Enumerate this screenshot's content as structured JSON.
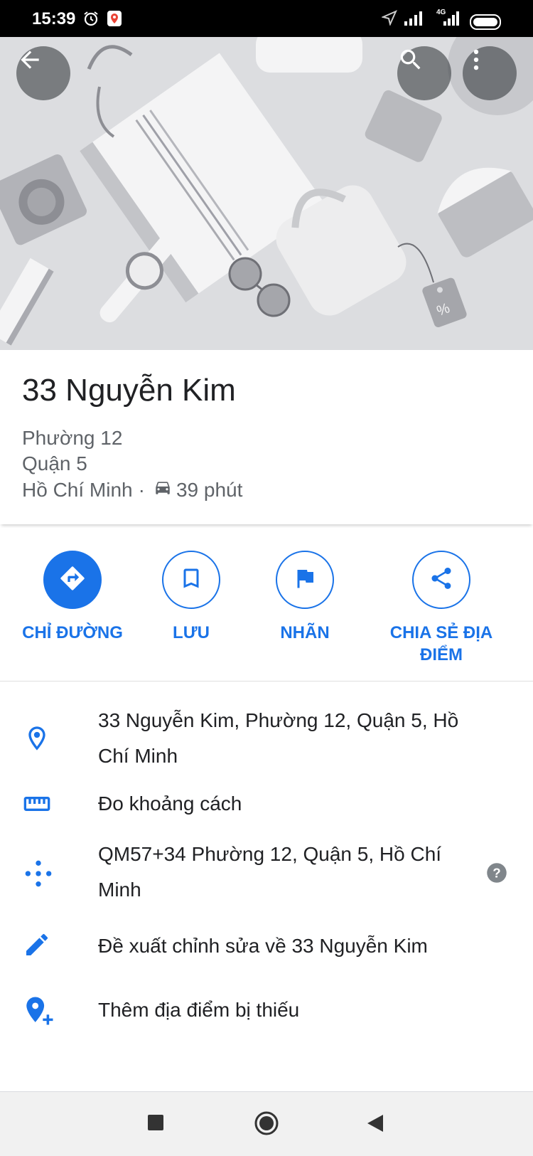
{
  "status_bar": {
    "time": "15:39",
    "icons": [
      "alarm-icon",
      "maps-notification-icon",
      "location-arrow-icon",
      "signal-icon",
      "4g-signal-icon",
      "battery-icon"
    ],
    "network_label": "4G"
  },
  "top_actions": {
    "back_icon": "arrow-back-icon",
    "search_icon": "search-icon",
    "more_icon": "more-vert-icon"
  },
  "place": {
    "title": "33 Nguyễn Kim",
    "ward": "Phường 12",
    "district": "Quận 5",
    "city": "Hồ Chí Minh",
    "separator": "·",
    "travel_time": "39 phút",
    "travel_mode_icon": "car-icon"
  },
  "actions": [
    {
      "label": "CHỈ ĐƯỜNG",
      "icon": "directions-icon"
    },
    {
      "label": "LƯU",
      "icon": "bookmark-icon"
    },
    {
      "label": "NHÃN",
      "icon": "flag-icon"
    },
    {
      "label_line1": "CHIA SẺ ĐỊA",
      "label_line2": "ĐIỂM",
      "icon": "share-icon"
    }
  ],
  "info_rows": [
    {
      "line1": "33 Nguyễn Kim, Phường 12, Quận 5, Hồ",
      "line2": "Chí Minh",
      "icon": "location-pin-icon"
    },
    {
      "text": "Đo khoảng cách",
      "icon": "ruler-icon"
    },
    {
      "line1": "QM57+34 Phường 12, Quận 5, Hồ Chí",
      "line2": "Minh",
      "icon": "plus-code-icon",
      "trailing_icon": "help-icon"
    },
    {
      "text": "Đề xuất chỉnh sửa về 33 Nguyễn Kim",
      "icon": "edit-pencil-icon"
    },
    {
      "text": "Thêm địa điểm bị thiếu",
      "icon": "add-location-icon"
    }
  ],
  "nav_bar": {
    "icons": [
      "recents-square-icon",
      "home-circle-icon",
      "back-triangle-icon"
    ]
  },
  "colors": {
    "accent": "#1a73e8",
    "text_primary": "#202124",
    "text_secondary": "#5f6368",
    "hero_background": "#dcdde0"
  }
}
